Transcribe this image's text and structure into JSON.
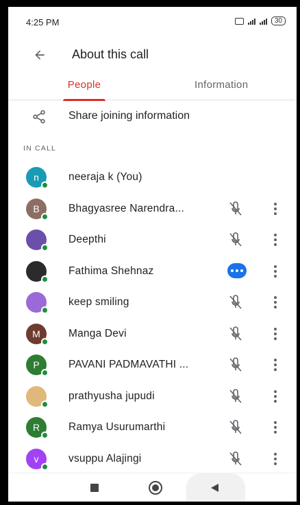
{
  "status_bar": {
    "time": "4:25 PM",
    "battery": "30"
  },
  "header": {
    "title": "About this call"
  },
  "tabs": [
    {
      "label": "People",
      "active": true
    },
    {
      "label": "Information",
      "active": false
    }
  ],
  "share": {
    "label": "Share joining information"
  },
  "section": {
    "label": "IN CALL"
  },
  "participants": [
    {
      "name": "neeraja k (You)",
      "avatar_letter": "n",
      "avatar_color": "#1a9bb5",
      "control": "none"
    },
    {
      "name": "Bhagyasree Narendra...",
      "avatar_letter": "B",
      "avatar_color": "#8d6e63",
      "control": "mic-off"
    },
    {
      "name": "Deepthi",
      "avatar_letter": "",
      "avatar_color": "#6b4fa8",
      "control": "mic-off"
    },
    {
      "name": "Fathima Shehnaz",
      "avatar_letter": "",
      "avatar_color": "#2b2b2b",
      "control": "more"
    },
    {
      "name": "keep smiling",
      "avatar_letter": "",
      "avatar_color": "#9c6ad6",
      "control": "mic-off"
    },
    {
      "name": "Manga Devi",
      "avatar_letter": "M",
      "avatar_color": "#6d3b2f",
      "control": "mic-off"
    },
    {
      "name": "PAVANI PADMAVATHI ...",
      "avatar_letter": "P",
      "avatar_color": "#2e7d32",
      "control": "mic-off"
    },
    {
      "name": "prathyusha jupudi",
      "avatar_letter": "",
      "avatar_color": "#e0b97a",
      "control": "mic-off"
    },
    {
      "name": "Ramya Usurumarthi",
      "avatar_letter": "R",
      "avatar_color": "#2e7d32",
      "control": "mic-off"
    },
    {
      "name": "vsuppu Alajingi",
      "avatar_letter": "v",
      "avatar_color": "#a142f4",
      "control": "mic-off"
    }
  ],
  "colors": {
    "accent": "#d93025",
    "online": "#1e8e3e",
    "more_button": "#1a73e8"
  }
}
